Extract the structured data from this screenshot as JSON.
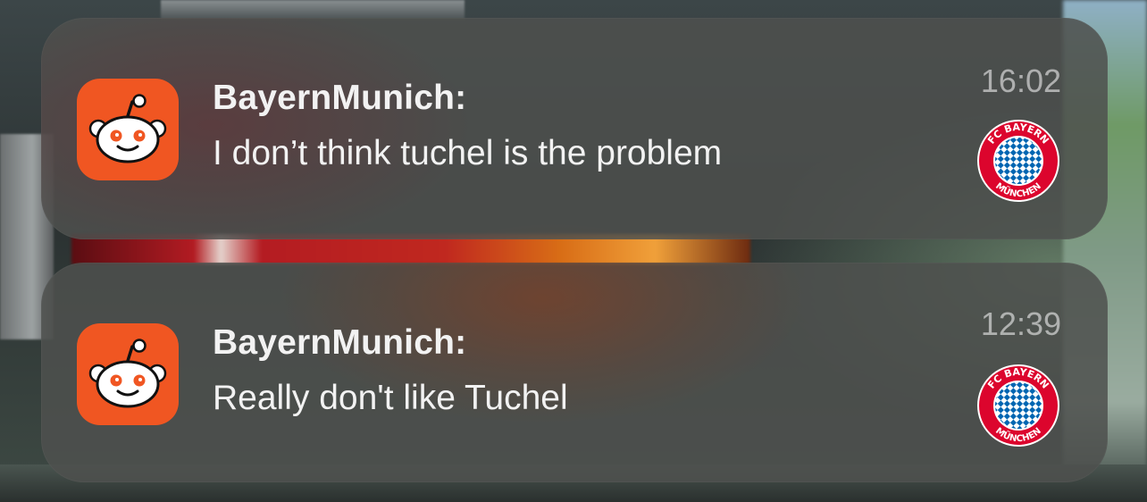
{
  "notifications": [
    {
      "app_icon": "reddit-app-icon",
      "title": "BayernMunich:",
      "body": "I don’t think tuchel is the problem",
      "time": "16:02",
      "thumbnail": "fc-bayern-munchen-logo",
      "thumbnail_text": "FC BAYERN MÜNCHEN"
    },
    {
      "app_icon": "reddit-app-icon",
      "title": "BayernMunich:",
      "body": "Really don't like Tuchel",
      "time": "12:39",
      "thumbnail": "fc-bayern-munchen-logo",
      "thumbnail_text": "FC BAYERN MÜNCHEN"
    }
  ],
  "colors": {
    "reddit_orange": "#f05622",
    "bayern_red": "#dc052d",
    "bayern_blue": "#0066b2",
    "notification_bg": "#4e504e",
    "text_primary": "#f2f2f2",
    "text_secondary": "#a8a8a8"
  }
}
